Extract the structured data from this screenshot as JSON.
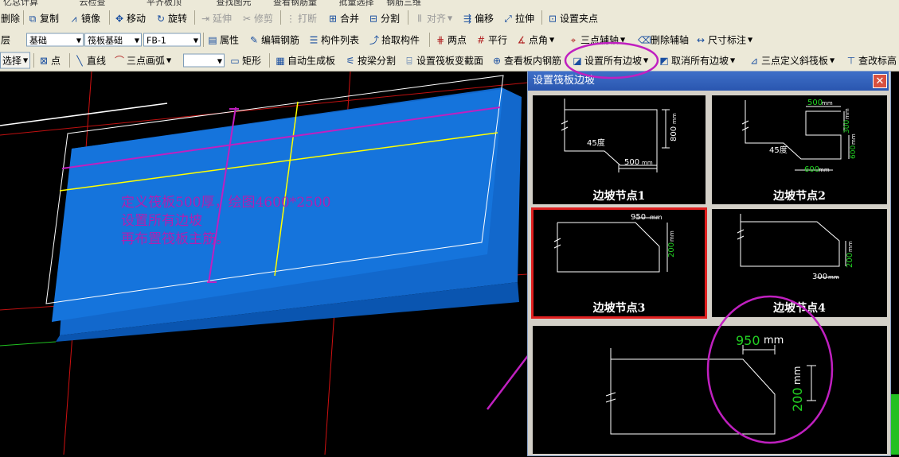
{
  "toolbar0": {
    "items": [
      "亿总计算",
      "云检查",
      "平齐板顶",
      "查找图元",
      "查看钢筋量",
      "批量选择",
      "钢筋三维"
    ]
  },
  "toolbar1": {
    "delete": "删除",
    "copy": "复制",
    "mirror": "镜像",
    "move": "移动",
    "rotate": "旋转",
    "extend": "延伸",
    "trim": "修剪",
    "break": "打断",
    "merge": "合并",
    "split": "分割",
    "align": "对齐",
    "offset": "偏移",
    "stretch": "拉伸",
    "set_grip": "设置夹点"
  },
  "toolbar2": {
    "floor": "层",
    "combo_type": "基础",
    "combo_category": "筏板基础",
    "combo_name": "FB-1",
    "properties": "属性",
    "edit_rebar": "编辑钢筋",
    "component_list": "构件列表",
    "pick_component": "拾取构件",
    "two_points": "两点",
    "parallel": "平行",
    "point_angle": "点角",
    "three_point_aux": "三点辅轴",
    "delete_aux": "删除辅轴",
    "dimension": "尺寸标注"
  },
  "toolbar3": {
    "select": "选择",
    "point": "点",
    "line": "直线",
    "three_point_arc": "三点画弧",
    "rect": "矩形",
    "auto_generate": "自动生成板",
    "split_by_beam": "按梁分割",
    "set_section_change": "设置筏板变截面",
    "view_rebar": "查看板内钢筋",
    "set_all_slopes": "设置所有边坡",
    "cancel_all_slopes": "取消所有边坡",
    "three_point_slope": "三点定义斜筏板",
    "modify_elevation": "查改标高"
  },
  "annotation": {
    "line1": "定义筏板500厚，绘图4600*2500",
    "line2": "设置所有边坡",
    "line3": "再布置筏板主筋。"
  },
  "dialog": {
    "title": "设置筏板边坡",
    "nodes": [
      {
        "label": "边坡节点1",
        "dims": [
          "45度",
          "500",
          "mm",
          "800",
          "mm"
        ]
      },
      {
        "label": "边坡节点2",
        "dims": [
          "500",
          "mm",
          "45度",
          "600",
          "mm",
          "300",
          "mm",
          "600",
          "mm"
        ]
      },
      {
        "label": "边坡节点3",
        "dims": [
          "950",
          "mm",
          "200",
          "mm"
        ]
      },
      {
        "label": "边坡节点4",
        "dims": [
          "300",
          "mm",
          "200",
          "mm"
        ]
      }
    ],
    "preview": {
      "top_value": "950",
      "top_unit": "mm",
      "side_value": "200",
      "side_unit": "mm"
    }
  },
  "colors": {
    "slab": "#1574dc",
    "highlight": "#b020b0",
    "dim_text": "#22d022",
    "selection_border": "#e02020"
  }
}
